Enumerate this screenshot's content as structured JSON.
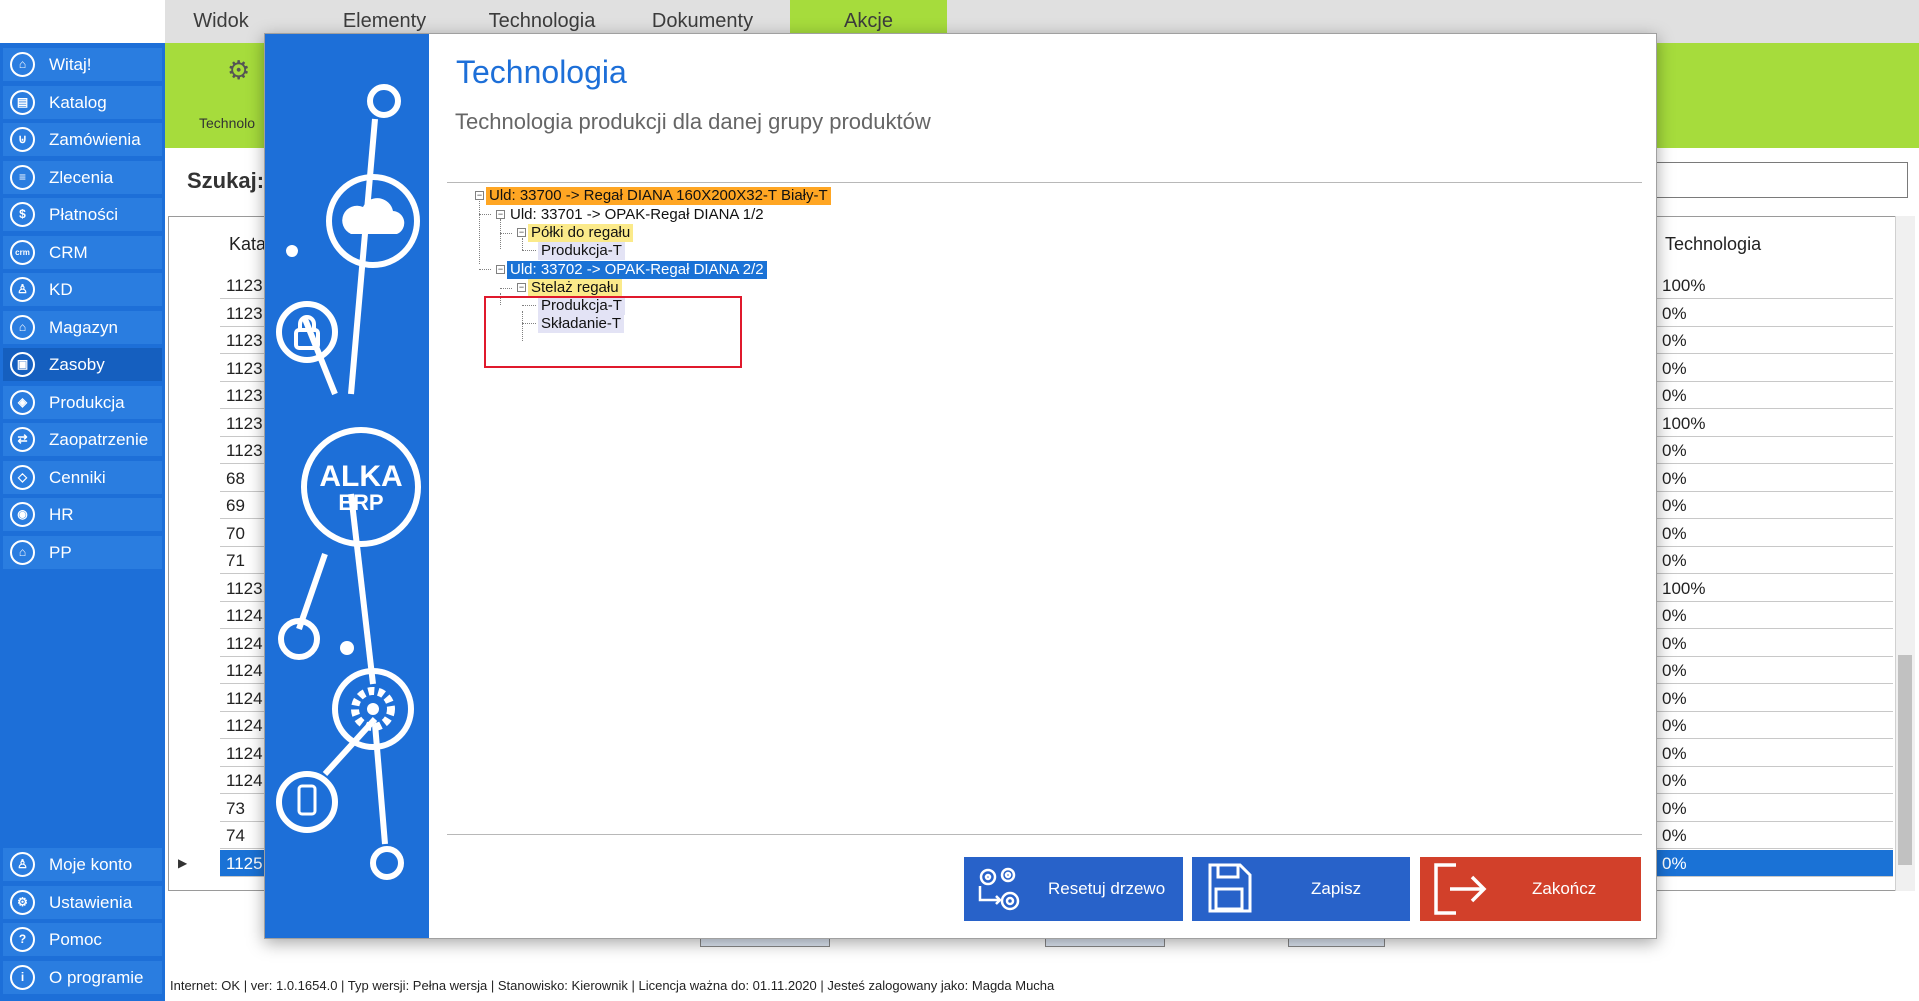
{
  "menu": {
    "tabs": [
      {
        "label": "Widok"
      },
      {
        "label": "Elementy"
      },
      {
        "label": "Technologia"
      },
      {
        "label": "Dokumenty"
      },
      {
        "label": "Akcje"
      }
    ]
  },
  "sidebar": {
    "items": [
      {
        "label": "Witaj!",
        "icon": "home-icon",
        "glyph": "⌂"
      },
      {
        "label": "Katalog",
        "icon": "catalog-icon",
        "glyph": "▤"
      },
      {
        "label": "Zamówienia",
        "icon": "cart-icon",
        "glyph": "⊍"
      },
      {
        "label": "Zlecenia",
        "icon": "list-icon",
        "glyph": "≡"
      },
      {
        "label": "Płatności",
        "icon": "dollar-icon",
        "glyph": "$"
      },
      {
        "label": "CRM",
        "icon": "crm-icon",
        "glyph": "crm"
      },
      {
        "label": "KD",
        "icon": "person-icon",
        "glyph": "♙"
      },
      {
        "label": "Magazyn",
        "icon": "warehouse-icon",
        "glyph": "⌂"
      },
      {
        "label": "Zasoby",
        "icon": "resources-icon",
        "glyph": "▣"
      },
      {
        "label": "Produkcja",
        "icon": "production-icon",
        "glyph": "◈"
      },
      {
        "label": "Zaopatrzenie",
        "icon": "supply-icon",
        "glyph": "⇄"
      },
      {
        "label": "Cenniki",
        "icon": "tag-icon",
        "glyph": "◇"
      },
      {
        "label": "HR",
        "icon": "hr-icon",
        "glyph": "◉"
      },
      {
        "label": "PP",
        "icon": "factory-icon",
        "glyph": "⌂"
      }
    ],
    "bottom_items": [
      {
        "label": "Moje konto",
        "icon": "account-icon",
        "glyph": "♙"
      },
      {
        "label": "Ustawienia",
        "icon": "settings-icon",
        "glyph": "⚙"
      },
      {
        "label": "Pomoc",
        "icon": "help-icon",
        "glyph": "?"
      },
      {
        "label": "O programie",
        "icon": "info-icon",
        "glyph": "i"
      }
    ]
  },
  "background": {
    "ribbon_label": "Technolo",
    "search_label": "Szukaj:",
    "col_kata": "Kata",
    "col_tech": "Technologia",
    "rows": [
      {
        "kata": "1123",
        "tech": "100%"
      },
      {
        "kata": "1123",
        "tech": "0%"
      },
      {
        "kata": "1123",
        "tech": "0%"
      },
      {
        "kata": "1123",
        "tech": "0%"
      },
      {
        "kata": "1123",
        "tech": "0%"
      },
      {
        "kata": "1123",
        "tech": "100%"
      },
      {
        "kata": "1123",
        "tech": "0%"
      },
      {
        "kata": "68",
        "tech": "0%"
      },
      {
        "kata": "69",
        "tech": "0%"
      },
      {
        "kata": "70",
        "tech": "0%"
      },
      {
        "kata": "71",
        "tech": "0%"
      },
      {
        "kata": "1123",
        "tech": "100%"
      },
      {
        "kata": "1124",
        "tech": "0%"
      },
      {
        "kata": "1124",
        "tech": "0%"
      },
      {
        "kata": "1124",
        "tech": "0%"
      },
      {
        "kata": "1124",
        "tech": "0%"
      },
      {
        "kata": "1124",
        "tech": "0%"
      },
      {
        "kata": "1124",
        "tech": "0%"
      },
      {
        "kata": "1124",
        "tech": "0%"
      },
      {
        "kata": "73",
        "tech": "0%"
      },
      {
        "kata": "74",
        "tech": "0%"
      },
      {
        "kata": "1125",
        "tech": "0%"
      }
    ]
  },
  "status": {
    "text": "Internet: OK  |  ver: 1.0.1654.0  |  Typ wersji: Pełna wersja  |  Stanowisko: Kierownik  |  Licencja ważna do: 01.11.2020  |  Jesteś zalogowany jako: Magda Mucha"
  },
  "modal": {
    "logo_text": "ALKA",
    "logo_sub": "ERP",
    "title": "Technologia",
    "subtitle": "Technologia produkcji dla danej grupy produktów",
    "tree": {
      "root": "Uld: 33700 -> Regał DIANA 160X200X32-T Biały-T",
      "n1": "Uld: 33701 -> OPAK-Regał DIANA   1/2",
      "n1_1": "Półki do regału",
      "n1_1_1": "Produkcja-T",
      "n2": "Uld: 33702 -> OPAK-Regał DIANA   2/2",
      "n2_1": "Stelaż regału",
      "n2_1_1": "Produkcja-T",
      "n2_1_2": "Składanie-T"
    },
    "buttons": {
      "reset": "Resetuj drzewo",
      "save": "Zapisz",
      "close": "Zakończ"
    }
  },
  "colors": {
    "sidebar": "#1d6fd8",
    "accent_green": "#a6dc3c",
    "tree_root": "#ffa623",
    "tree_group": "#fbea8a",
    "selection": "#1a72d6",
    "close_button": "#d2402a"
  }
}
